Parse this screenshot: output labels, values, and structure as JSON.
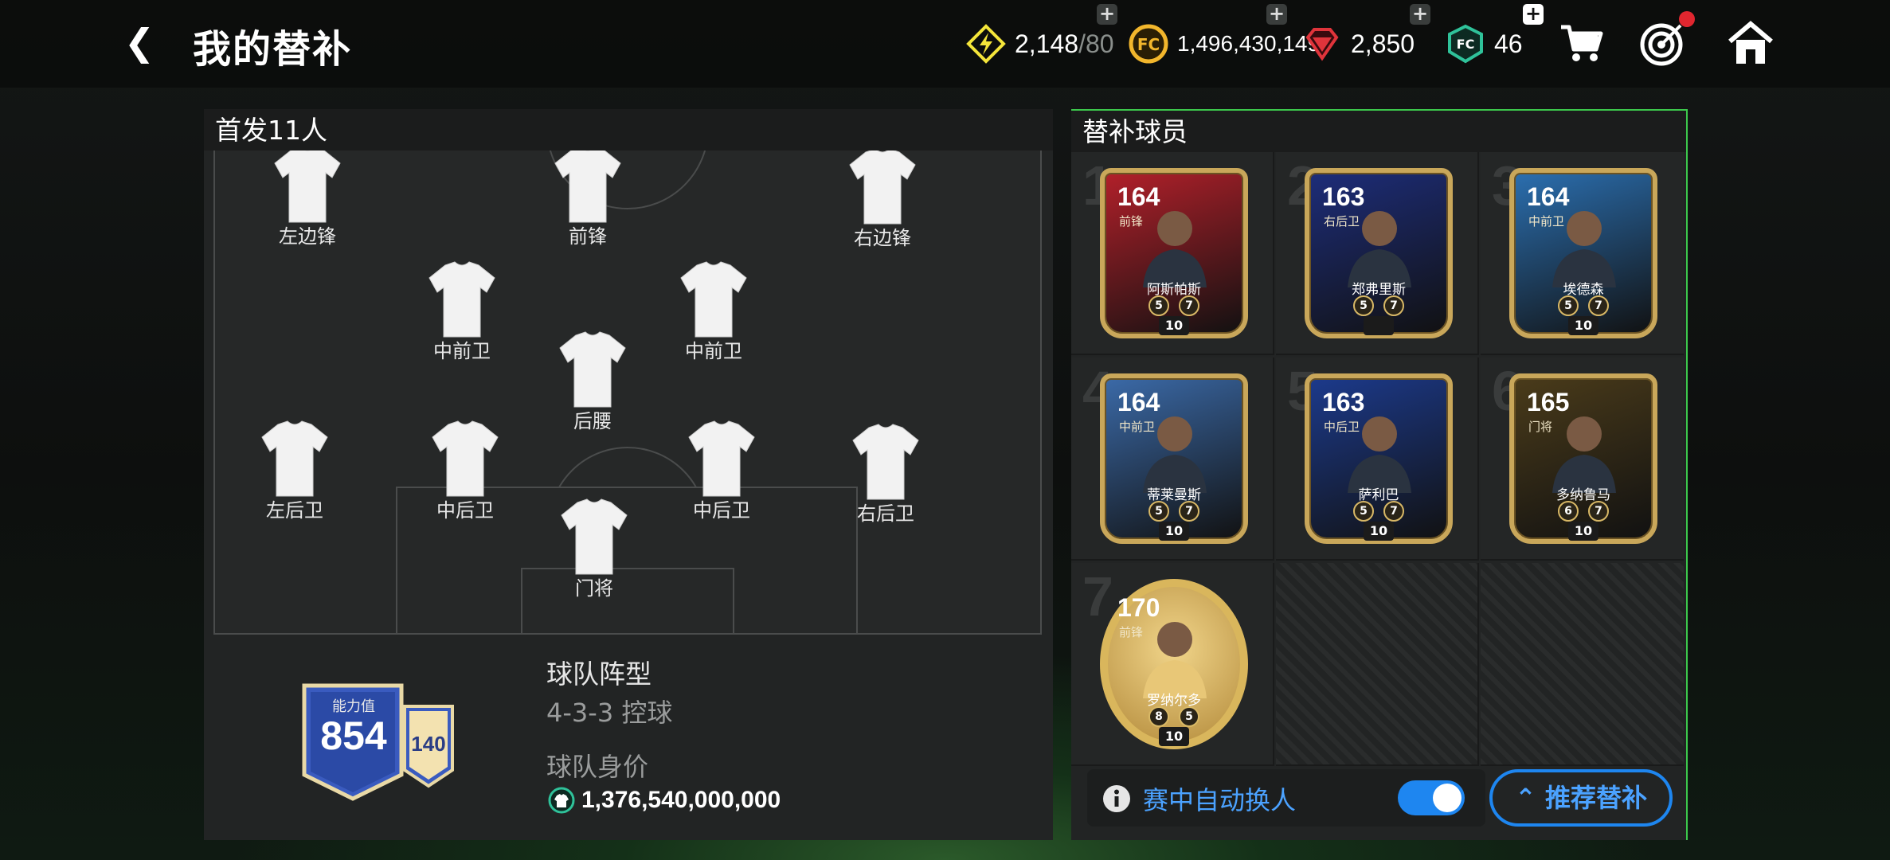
{
  "header": {
    "title": "我的替补",
    "currencies": [
      {
        "name": "energy",
        "icon": "lightning-icon",
        "value": "2,148",
        "max": "/80",
        "color": "#f4e53a"
      },
      {
        "name": "coins",
        "icon": "coin-icon",
        "value": "1,496,430,149",
        "color": "#f2b62c"
      },
      {
        "name": "gems",
        "icon": "gem-icon",
        "value": "2,850",
        "color": "#e0343b"
      },
      {
        "name": "fc-points",
        "icon": "fc-points-icon",
        "value": "46",
        "color": "#2fc29a"
      }
    ]
  },
  "lineup": {
    "title": "首发11人",
    "positions": [
      "左边锋",
      "前锋",
      "右边锋",
      "中前卫",
      "中前卫",
      "后腰",
      "左后卫",
      "中后卫",
      "中后卫",
      "右后卫",
      "门将"
    ]
  },
  "team": {
    "ovr_label": "能力值",
    "ovr": "854",
    "chem": "140",
    "formation_label": "球队阵型",
    "formation": "4-3-3 控球",
    "value_label": "球队身价",
    "value": "1,376,540,000,000"
  },
  "subs": {
    "title": "替补球员",
    "players": [
      {
        "slot": "1",
        "rating": "164",
        "position": "前锋",
        "name": "阿斯帕斯",
        "pip1": "5",
        "pip2": "7",
        "level": "10",
        "color": "#b2202a"
      },
      {
        "slot": "2",
        "rating": "163",
        "position": "右后卫",
        "name": "郑弗里斯",
        "pip1": "5",
        "pip2": "7",
        "level": "",
        "color": "#1d2d7a"
      },
      {
        "slot": "3",
        "rating": "164",
        "position": "中前卫",
        "name": "埃德森",
        "pip1": "5",
        "pip2": "7",
        "level": "10",
        "color": "#2b6fb0"
      },
      {
        "slot": "4",
        "rating": "164",
        "position": "中前卫",
        "name": "蒂莱曼斯",
        "pip1": "5",
        "pip2": "7",
        "level": "10",
        "color": "#3b6aa8"
      },
      {
        "slot": "5",
        "rating": "163",
        "position": "中后卫",
        "name": "萨利巴",
        "pip1": "5",
        "pip2": "7",
        "level": "10",
        "color": "#1c3a8c"
      },
      {
        "slot": "6",
        "rating": "165",
        "position": "门将",
        "name": "多纳鲁马",
        "pip1": "6",
        "pip2": "7",
        "level": "10",
        "color": "#4a3b1a"
      },
      {
        "slot": "7",
        "rating": "170",
        "position": "前锋",
        "name": "罗纳尔多",
        "pip1": "8",
        "pip2": "5",
        "level": "10",
        "color": "#c9a14a"
      }
    ],
    "auto_sub_label": "赛中自动换人",
    "auto_sub_on": true,
    "recommend_label": "推荐替补"
  }
}
